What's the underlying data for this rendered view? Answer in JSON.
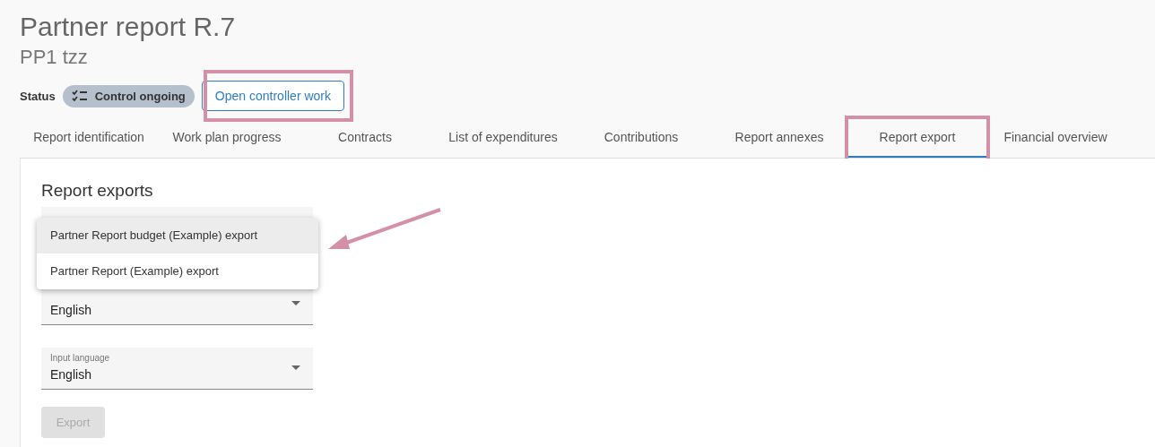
{
  "header": {
    "title": "Partner report R.7",
    "subtitle": "PP1 tzz"
  },
  "status": {
    "label": "Status",
    "chip": "Control ongoing"
  },
  "open_button": {
    "label": "Open controller work"
  },
  "tabs": [
    {
      "label": "Report identification",
      "selected": false
    },
    {
      "label": "Work plan progress",
      "selected": false
    },
    {
      "label": "Contracts",
      "selected": false
    },
    {
      "label": "List of expenditures",
      "selected": false
    },
    {
      "label": "Contributions",
      "selected": false
    },
    {
      "label": "Report annexes",
      "selected": false
    },
    {
      "label": "Report export",
      "selected": true
    },
    {
      "label": "Financial overview",
      "selected": false
    }
  ],
  "section_title": "Report exports",
  "fields": [
    {
      "kind": "select",
      "value": "English"
    },
    {
      "kind": "select",
      "label": "Input language",
      "value": "English"
    }
  ],
  "menu": {
    "items": [
      {
        "label": "Partner Report budget (Example) export",
        "selected": true
      },
      {
        "label": "Partner Report (Example) export",
        "selected": false
      }
    ]
  },
  "export_button": {
    "label": "Export",
    "disabled": true
  }
}
